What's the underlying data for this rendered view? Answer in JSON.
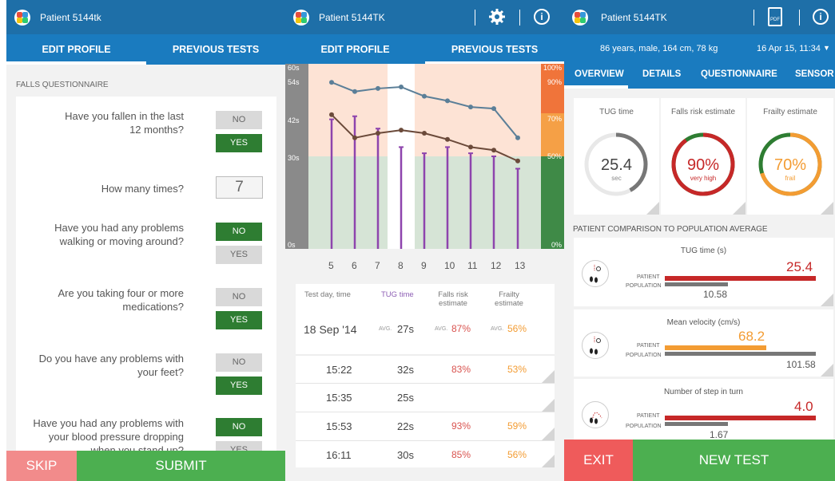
{
  "panel1": {
    "header": {
      "patient": "Patient 5144tk"
    },
    "tabs": [
      "EDIT PROFILE",
      "PREVIOUS TESTS"
    ],
    "section_title": "FALLS QUESTIONNAIRE",
    "questions": [
      {
        "line1": "Have you fallen in the last",
        "line2": "12 months?",
        "no": "NO",
        "yes": "YES"
      },
      {
        "line1": "How many times?",
        "value": "7"
      },
      {
        "line1": "Have you had any problems",
        "line2": "walking or moving around?",
        "no": "NO",
        "yes": "YES"
      },
      {
        "line1": "Are you taking four or more",
        "line2": "medications?",
        "no": "NO",
        "yes": "YES"
      },
      {
        "line1": "Do you have any problems with",
        "line2": "your feet?",
        "no": "NO",
        "yes": "YES"
      },
      {
        "line1": "Have you had any problems with",
        "line2": "your blood pressure dropping",
        "line3": "when you stand up?",
        "no": "NO",
        "yes": "YES"
      }
    ],
    "skip": "SKIP",
    "submit": "SUBMIT"
  },
  "panel2": {
    "header": {
      "patient": "Patient 5144TK"
    },
    "tabs": [
      "EDIT PROFILE",
      "PREVIOUS TESTS"
    ],
    "table": {
      "headers": {
        "day": "Test day, time",
        "tug": "TUG time",
        "falls": "Falls risk estimate",
        "frailty": "Frailty estimate"
      },
      "summary": {
        "date": "18 Sep '14",
        "avg": "AVG.",
        "tug": "27s",
        "falls": "87%",
        "frailty": "56%"
      },
      "rows": [
        {
          "time": "15:22",
          "tug": "32s",
          "falls": "83%",
          "frailty": "53%"
        },
        {
          "time": "15:35",
          "tug": "25s",
          "falls": "",
          "frailty": ""
        },
        {
          "time": "15:53",
          "tug": "22s",
          "falls": "93%",
          "frailty": "59%"
        },
        {
          "time": "16:11",
          "tug": "30s",
          "falls": "85%",
          "frailty": "56%"
        }
      ]
    }
  },
  "panel3": {
    "header": {
      "patient": "Patient 5144TK"
    },
    "info": "86 years, male, 164 cm, 78 kg",
    "date": "16 Apr 15, 11:34",
    "tabs": [
      "OVERVIEW",
      "DETAILS",
      "QUESTIONNAIRE",
      "SENSOR"
    ],
    "cards": [
      {
        "label": "TUG time",
        "value": "25.4",
        "unit": "sec",
        "fraction": 0.42,
        "color": "#777777"
      },
      {
        "label": "Falls risk estimate",
        "value": "90%",
        "unit": "very high",
        "fraction": 0.9,
        "color": "#c62828"
      },
      {
        "label": "Frailty estimate",
        "value": "70%",
        "unit": "frail",
        "fraction": 0.7,
        "color": "#f39c33"
      }
    ],
    "comparison_title": "PATIENT COMPARISON TO POPULATION AVERAGE",
    "patient_label": "PATIENT",
    "population_label": "POPULATION",
    "comparisons": [
      {
        "title": "TUG time (s)",
        "patient": "25.4",
        "population": "10.58",
        "patient_color": "#c62828"
      },
      {
        "title": "Mean velocity (cm/s)",
        "patient": "68.2",
        "population": "101.58",
        "patient_color": "#f39c33"
      },
      {
        "title": "Number of step in turn",
        "patient": "4.0",
        "population": "1.67",
        "patient_color": "#c62828"
      }
    ],
    "exit": "EXIT",
    "new_test": "NEW TEST"
  },
  "chart_data": {
    "type": "line",
    "x": [
      5,
      6,
      7,
      8,
      9,
      10,
      11,
      12,
      13
    ],
    "left_axis_ticks": [
      "60s",
      "54s",
      "42s",
      "30s",
      "0s"
    ],
    "right_axis_ticks": [
      "100%",
      "90%",
      "70%",
      "50%",
      "0%"
    ],
    "series": [],
    "tug_line": [
      54,
      51,
      52,
      52.5,
      49.5,
      48,
      46,
      45.5,
      36
    ],
    "risk_line": [
      43.5,
      36,
      37.5,
      38.5,
      37.5,
      35.5,
      33,
      32,
      28.5
    ],
    "bars": [
      42,
      43,
      39,
      33,
      31,
      33,
      31,
      30,
      26
    ]
  }
}
